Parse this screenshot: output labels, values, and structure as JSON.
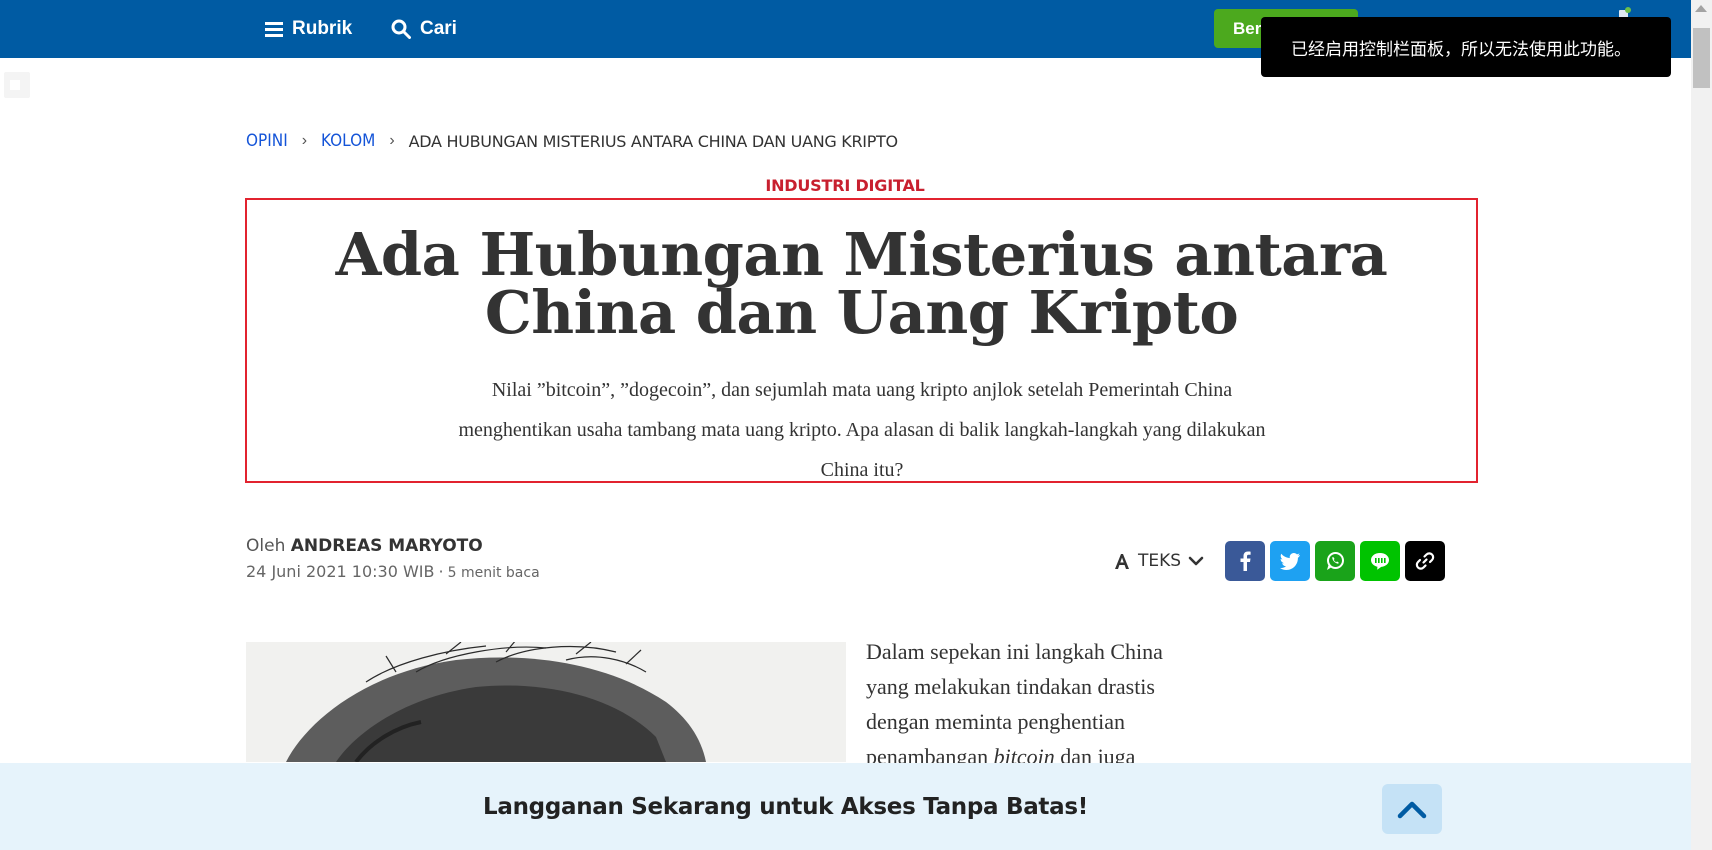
{
  "nav": {
    "menu_label": "Rubrik",
    "search_label": "Cari",
    "green_button_label": "Berl"
  },
  "toast": {
    "message": "已经启用控制栏面板，所以无法使用此功能。"
  },
  "breadcrumb": {
    "items": [
      "OPINI",
      "KOLOM"
    ],
    "current": "ADA HUBUNGAN MISTERIUS ANTARA CHINA DAN UANG KRIPTO",
    "separator": "›"
  },
  "article": {
    "category": "INDUSTRI DIGITAL",
    "title": "Ada Hubungan Misterius antara China dan Uang Kripto",
    "summary": "Nilai ”bitcoin”, ”dogecoin”, dan sejumlah mata uang kripto anjlok setelah Pemerintah China menghentikan usaha tambang mata uang kripto. Apa alasan di balik langkah-langkah yang dilakukan China itu?",
    "byline_prefix": "Oleh",
    "author": "ANDREAS MARYOTO",
    "date": "24 Juni 2021 10:30 WIB",
    "dot": "·",
    "read_time": "5 menit baca",
    "text_size_label": "TEKS",
    "body_lines": [
      "Dalam sepekan ini langkah China",
      "yang melakukan tindakan drastis",
      "dengan meminta penghentian"
    ],
    "body_last_line_before": "penambangan ",
    "body_last_line_italic": "bitcoin",
    "body_last_line_after": " dan juga"
  },
  "share": {
    "icons": [
      "facebook-icon",
      "twitter-icon",
      "whatsapp-icon",
      "line-icon",
      "link-icon"
    ]
  },
  "subscribe": {
    "label": "Langganan Sekarang untuk Akses Tanpa Batas!"
  },
  "colors": {
    "nav_bg": "#005ba3",
    "accent_red": "#e2232f",
    "link_blue": "#1454d8",
    "banner_bg": "#e6f3fb"
  }
}
